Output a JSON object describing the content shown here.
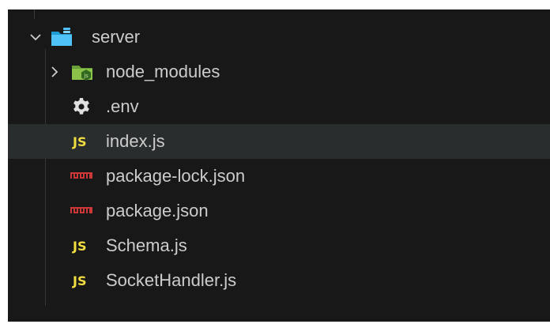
{
  "explorer": {
    "root": {
      "label": "server",
      "expanded": true,
      "icon": "server-folder-icon",
      "icon_color": "#4fc3f7"
    },
    "items": [
      {
        "label": "node_modules",
        "type": "folder",
        "expanded": false,
        "icon": "node-modules-folder-icon",
        "icon_color": "#8bc34a"
      },
      {
        "label": ".env",
        "type": "file",
        "icon": "gear-icon",
        "icon_color": "#e0e0e0"
      },
      {
        "label": "index.js",
        "type": "file",
        "icon": "js-icon",
        "badge": "JS",
        "icon_color": "#f1dd3f",
        "selected": true
      },
      {
        "label": "package-lock.json",
        "type": "file",
        "icon": "npm-icon",
        "icon_color": "#cb3837"
      },
      {
        "label": "package.json",
        "type": "file",
        "icon": "npm-icon",
        "icon_color": "#cb3837"
      },
      {
        "label": "Schema.js",
        "type": "file",
        "icon": "js-icon",
        "badge": "JS",
        "icon_color": "#f1dd3f"
      },
      {
        "label": "SocketHandler.js",
        "type": "file",
        "icon": "js-icon",
        "badge": "JS",
        "icon_color": "#f1dd3f"
      }
    ]
  },
  "colors": {
    "background": "#181818",
    "text": "#cccccc",
    "selected_row": "#2a2d2e"
  }
}
